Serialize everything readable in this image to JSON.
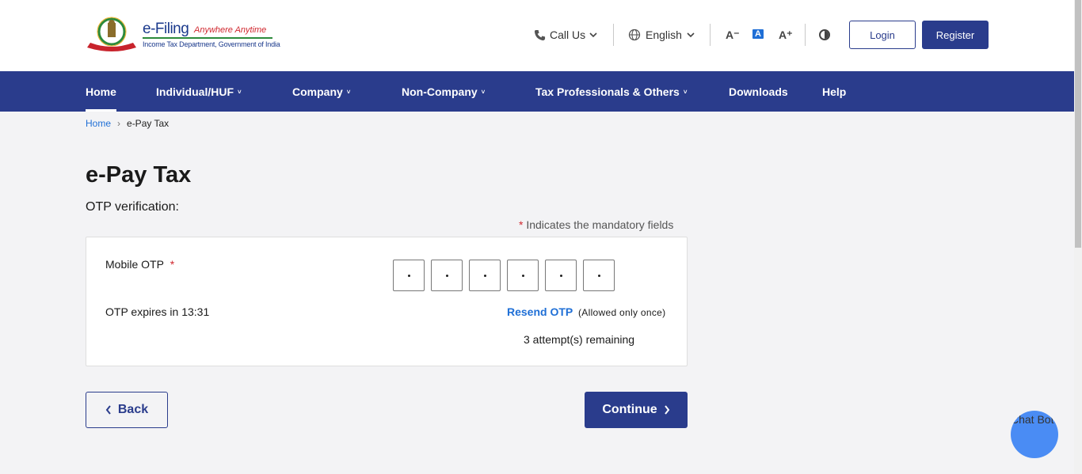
{
  "header": {
    "logo_title": "e-Filing",
    "logo_tagline": "Anywhere Anytime",
    "logo_subtitle": "Income Tax Department, Government of India",
    "call_us": "Call Us",
    "language": "English",
    "font_decrease": "A⁻",
    "font_normal": "A",
    "font_increase": "A⁺",
    "login_label": "Login",
    "register_label": "Register"
  },
  "nav": {
    "items": [
      {
        "label": "Home",
        "dropdown": false,
        "active": true
      },
      {
        "label": "Individual/HUF",
        "dropdown": true
      },
      {
        "label": "Company",
        "dropdown": true
      },
      {
        "label": "Non-Company",
        "dropdown": true
      },
      {
        "label": "Tax Professionals & Others",
        "dropdown": true
      },
      {
        "label": "Downloads",
        "dropdown": false
      },
      {
        "label": "Help",
        "dropdown": false
      }
    ],
    "caret": "˅"
  },
  "breadcrumb": {
    "home": "Home",
    "separator": "›",
    "current": "e-Pay Tax"
  },
  "page": {
    "title": "e-Pay Tax",
    "subtitle": "OTP verification:",
    "mandatory_star": "*",
    "mandatory_text": " Indicates the mandatory fields"
  },
  "otp_card": {
    "label": "Mobile OTP",
    "required_star": "*",
    "digits": [
      "•",
      "•",
      "•",
      "•",
      "•",
      "•"
    ],
    "expires_text": "OTP expires in 13:31",
    "resend_label": "Resend OTP",
    "allowed_note": "(Allowed only once)",
    "attempts_text": "3 attempt(s) remaining"
  },
  "actions": {
    "back_label": "Back",
    "continue_label": "Continue"
  },
  "chatbot": {
    "alt_text": "Chat Bot"
  },
  "colors": {
    "primary": "#2a3c8c",
    "link": "#1f6fd6",
    "required": "#d0282f",
    "background": "#f3f3f5"
  }
}
